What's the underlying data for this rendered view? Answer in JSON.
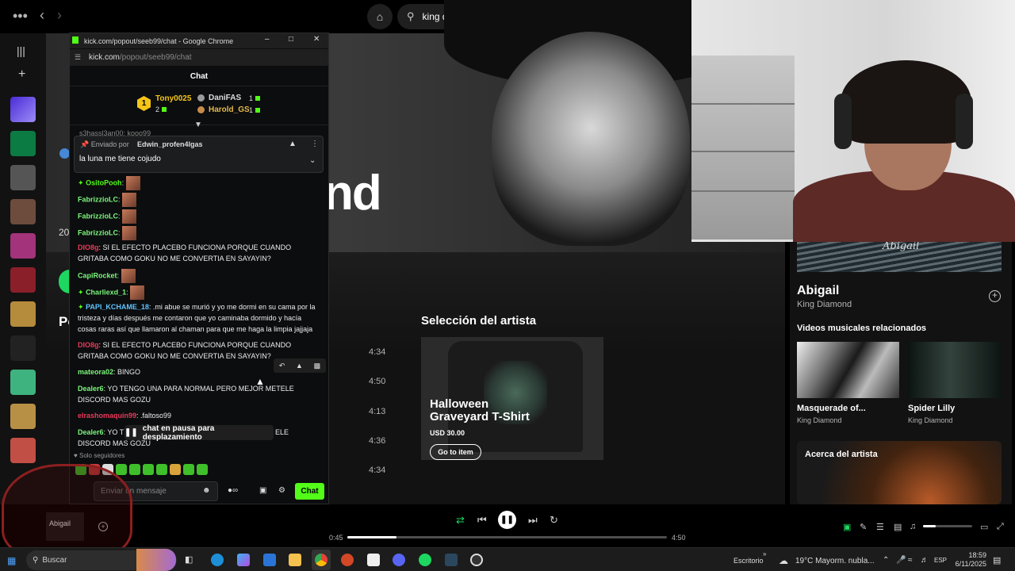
{
  "spotify": {
    "search_value": "king diamo",
    "artist_title_fragment": "nd",
    "side_number": "20",
    "side_heading": "Po",
    "durations": [
      "4:34",
      "4:50",
      "4:13",
      "4:36",
      "4:34"
    ],
    "artist_pick_heading": "Selección del artista",
    "merch": {
      "name": "Halloween Graveyard T-Shirt",
      "price": "USD 30.00",
      "button": "Go to item"
    },
    "now_playing": {
      "art_text": "Abigail",
      "title": "Abigail",
      "artist": "King Diamond"
    },
    "related_heading": "Videos musicales relacionados",
    "related": [
      {
        "title": "Masquerade of...",
        "artist": "King Diamond"
      },
      {
        "title": "Spider Lilly",
        "artist": "King Diamond"
      }
    ],
    "about_heading": "Acerca del artista",
    "player": {
      "track_label": "Abigail",
      "elapsed": "0:45",
      "total": "4:50",
      "progress_fraction": 0.155,
      "volume_fraction": 0.25
    }
  },
  "chat": {
    "window_title": "kick.com/popout/seeb99/chat - Google Chrome",
    "url_domain": "kick.com",
    "url_path": "/popout/seeb99/chat",
    "header": "Chat",
    "leaderboard": {
      "first_name": "Tony0025",
      "first_rank": "1",
      "first_count": "2",
      "second_name": "DaniFAS",
      "second_count": "1",
      "third_name": "Harold_GS",
      "third_count": "1"
    },
    "behind_pinned_user": "s3hassl3an00: kooo99",
    "pinned": {
      "by_label": "Enviado por",
      "by_user": "Edwin_profen4lgas",
      "message": "la luna me tiene cojudo"
    },
    "messages": [
      {
        "user": "OsitoPooh",
        "text": ":"
      },
      {
        "user": "FabrizzioLC",
        "text": ":"
      },
      {
        "user": "FabrizzioLC",
        "text": ":"
      },
      {
        "user": "FabrizzioLC",
        "text": ":"
      },
      {
        "user": "DIO8g",
        "text": ": SI EL EFECTO PLACEBO FUNCIONA PORQUE CUANDO GRITABA COMO GOKU NO ME CONVERTIA EN SAYAYIN?"
      },
      {
        "user": "CapiRocket",
        "text": ":"
      },
      {
        "user": "Charliexd_1",
        "text": ":"
      },
      {
        "user": "PAPI_KCHAME_18",
        "text": ": .mi abue se murió y yo me dormi en su cama por la tristeza y días después me contaron que yo caminaba dormido y hacía cosas raras así que llamaron al chaman para que me haga la limpia jajjaja"
      },
      {
        "user": "DIO8g",
        "text": ": SI EL EFECTO PLACEBO FUNCIONA PORQUE CUANDO GRITABA COMO GOKU NO ME CONVERTIA EN SAYAYIN?"
      },
      {
        "user": "mateora02",
        "text": ": BINGO"
      },
      {
        "user": "Dealer6",
        "text": ": YO TENGO UNA PARA NORMAL PERO MEJOR METELE DISCORD MAS GOZU"
      },
      {
        "user": "elrashomaquin99",
        "text": ": .faltoso99"
      },
      {
        "user": "Dealer6",
        "text": ": YO T",
        "text_tail": "ELE",
        "text_line2": "DISCORD MAS GOZU"
      }
    ],
    "paused_notice": "chat en pausa para desplazamiento",
    "followers_only": "Solo seguidores",
    "input_placeholder": "Enviar un mensaje",
    "send_label": "Chat"
  },
  "overlay_logo_text": "Abigail",
  "taskbar": {
    "search_text": "Buscar",
    "desktop_label": "Escritorio",
    "weather": "19°C  Mayorm. nubla...",
    "language": "ESP",
    "time": "18:59",
    "date": "6/11/2025"
  },
  "colors": {
    "spotify_green": "#1ed760",
    "kick_green": "#53fc18"
  }
}
